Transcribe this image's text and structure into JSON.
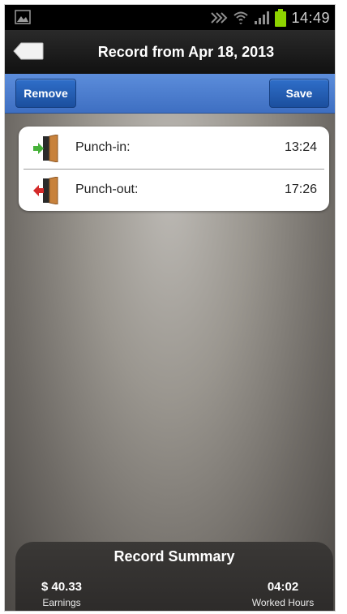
{
  "status_bar": {
    "time": "14:49",
    "icons": [
      "gallery-icon",
      "vibrate-icon",
      "wifi-icon",
      "signal-icon",
      "battery-icon"
    ],
    "battery_color": "#8ed400"
  },
  "header": {
    "title": "Record from Apr 18, 2013",
    "back_icon": "back-arrow-icon"
  },
  "toolbar": {
    "remove_label": "Remove",
    "save_label": "Save",
    "accent": "#3e6fc2"
  },
  "records": [
    {
      "label": "Punch-in:",
      "time": "13:24",
      "icon": "door-enter-icon",
      "arrow_color": "#47b23a"
    },
    {
      "label": "Punch-out:",
      "time": "17:26",
      "icon": "door-exit-icon",
      "arrow_color": "#d42a2a"
    }
  ],
  "summary": {
    "title": "Record Summary",
    "earnings_value": "$ 40.33",
    "earnings_label": "Earnings",
    "hours_value": "04:02",
    "hours_label": "Worked Hours"
  }
}
